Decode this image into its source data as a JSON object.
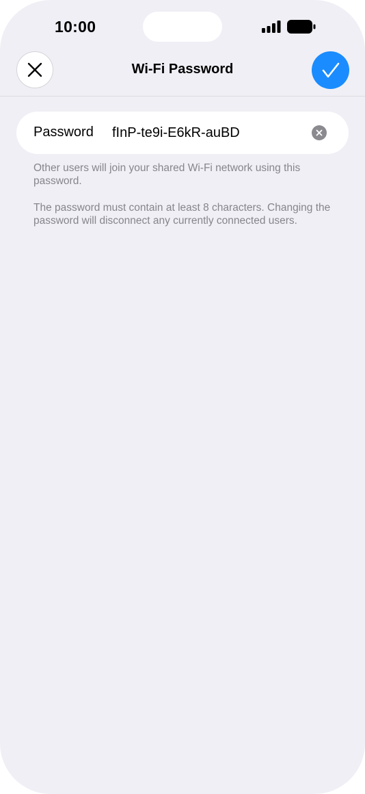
{
  "status_bar": {
    "time": "10:00"
  },
  "nav": {
    "title": "Wi-Fi Password",
    "close_icon": "xmark-icon",
    "done_icon": "checkmark-icon"
  },
  "password_field": {
    "label": "Password",
    "value": "fInP-te9i-E6kR-auBD",
    "clear_icon": "xmark-circle-icon"
  },
  "footer": {
    "note_1": "Other users will join your shared Wi-Fi network using this password.",
    "note_2": "The password must contain at least 8 characters. Changing the password will disconnect any currently connected users."
  },
  "colors": {
    "accent": "#1a8cff",
    "background": "#f0eff5",
    "secondary_text": "#85858b"
  }
}
